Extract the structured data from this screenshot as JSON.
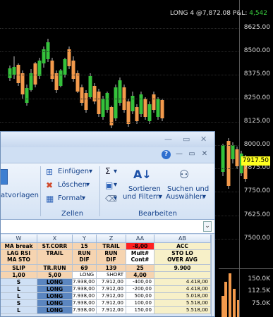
{
  "chart": {
    "header_prefix": "LONG 4 @7,872.08 P&L:",
    "header_pl": "4,542",
    "price_axis": [
      "8625.00",
      "8500.00",
      "8375.00",
      "8250.00",
      "8125.00",
      "8000.00",
      "7875.00",
      "7750.00",
      "7625.00",
      "7500.00"
    ],
    "last_price": "7917.50",
    "volume_axis": [
      "150.0K",
      "112.5K",
      "75.0K"
    ],
    "colors": {
      "up": "#35c13b",
      "down": "#f39a4c",
      "flag": "#ffff20"
    }
  },
  "excel": {
    "ribbon": {
      "insert_label": "Einfügen",
      "delete_label": "Löschen",
      "format_label": "Format",
      "cells_group": "Zellen",
      "sort_label_1": "Sortieren",
      "sort_label_2": "und Filtern",
      "find_label_1": "Suchen und",
      "find_label_2": "Auswählen",
      "edit_group": "Bearbeiten",
      "styles_partial": "atvorlagen"
    },
    "columns": [
      "W",
      "X",
      "Y",
      "Z",
      "AA",
      "AB"
    ],
    "header_row1": [
      "MA break",
      "ST.CORR",
      "15",
      "TRAIL",
      "-8,00",
      "ACC"
    ],
    "header_row2": [
      "LAG RSI\nMA STO",
      "TRAIL",
      "RUN\nDIF",
      "RUN\nDIF",
      "Mult#\nCont#",
      "STO LO\nOVER AVG"
    ],
    "header_row3": [
      "SLIP",
      "TR.RUN",
      "69",
      "139",
      "25",
      "9.900"
    ],
    "header_row4": [
      "1,00",
      "5,00",
      "LONG",
      "SHORT",
      "4,00",
      ""
    ],
    "rows": [
      [
        "S",
        "LONG",
        "7.938,00",
        "7.912,00",
        "-400,00",
        "4.418,00"
      ],
      [
        "L",
        "LONG",
        "7.938,00",
        "7.912,00",
        "-200,00",
        "4.418,00"
      ],
      [
        "L",
        "LONG",
        "7.938,00",
        "7.912,00",
        "500,00",
        "5.018,00"
      ],
      [
        "S",
        "LONG",
        "7.938,00",
        "7.912,00",
        "100,00",
        "5.518,00"
      ],
      [
        "L",
        "LONG",
        "7.938,00",
        "7.912,00",
        "150,00",
        "5.518,00"
      ]
    ]
  }
}
